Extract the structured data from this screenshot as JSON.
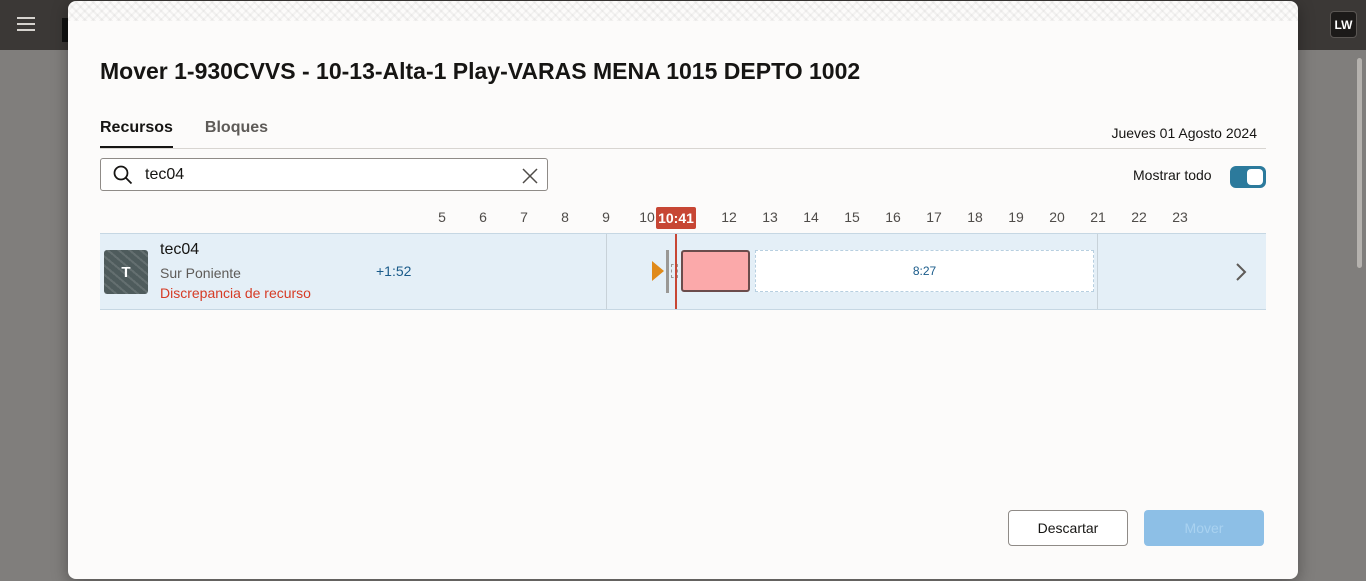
{
  "app": {
    "menu_icon": "hamburger-menu-icon",
    "user_initials": "LW"
  },
  "dialog": {
    "title": "Mover 1-930CVVS - 10-13-Alta-1 Play-VARAS MENA 1015 DEPTO 1002",
    "tabs": [
      {
        "label": "Recursos",
        "active": true
      },
      {
        "label": "Bloques",
        "active": false
      }
    ],
    "date": "Jueves 01 Agosto 2024",
    "search": {
      "value": "tec04",
      "icon": "search-icon",
      "clear_icon": "close-icon"
    },
    "show_all": {
      "label": "Mostrar todo",
      "enabled": true
    },
    "timeline": {
      "hours": [
        "5",
        "6",
        "7",
        "8",
        "9",
        "10",
        "12",
        "13",
        "14",
        "15",
        "16",
        "17",
        "18",
        "19",
        "20",
        "21",
        "22",
        "23"
      ],
      "current_time": "10:41"
    },
    "resource": {
      "avatar_letter": "T",
      "name": "tec04",
      "area": "Sur Poniente",
      "warning": "Discrepancia de recurso",
      "offset": "+1:52",
      "free_slot_label": "8:27",
      "colors": {
        "activity": "#fba9aa",
        "warning": "#d63b25",
        "now": "#c74634",
        "start_marker": "#e08a1a"
      }
    },
    "buttons": {
      "discard": "Descartar",
      "move": "Mover"
    }
  }
}
